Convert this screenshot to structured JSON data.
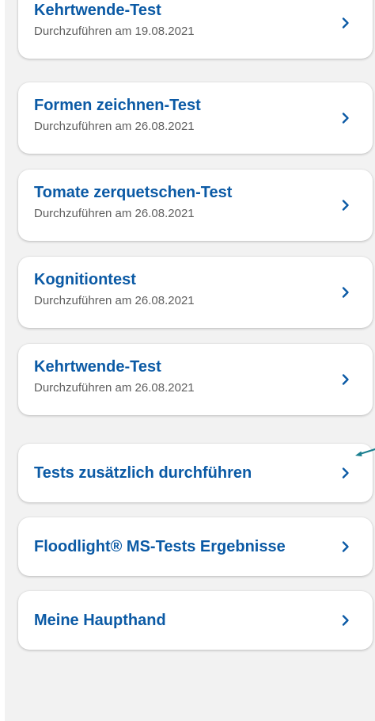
{
  "colors": {
    "accent": "#0b5aa5",
    "subtitle": "#5f5f5f",
    "background": "#f2f2f2",
    "card": "#ffffff",
    "annotation_arrow": "#1a7f8f"
  },
  "tests": [
    {
      "title": "Kehrtwende-Test",
      "subtitle": "Durchzuführen am 19.08.2021"
    },
    {
      "title": "Formen zeichnen-Test",
      "subtitle": "Durchzuführen am 26.08.2021"
    },
    {
      "title": "Tomate zerquetschen-Test",
      "subtitle": "Durchzuführen am 26.08.2021"
    },
    {
      "title": "Kognitiontest",
      "subtitle": "Durchzuführen am 26.08.2021"
    },
    {
      "title": "Kehrtwende-Test",
      "subtitle": "Durchzuführen am 26.08.2021"
    }
  ],
  "actions": [
    {
      "title": "Tests zusätzlich durchführen"
    },
    {
      "title": "Floodlight® MS-Tests Ergebnisse"
    },
    {
      "title": "Meine Haupthand"
    }
  ],
  "icons": {
    "chevron": "chevron-right-icon",
    "annotation": "arrow-pointer-icon"
  }
}
